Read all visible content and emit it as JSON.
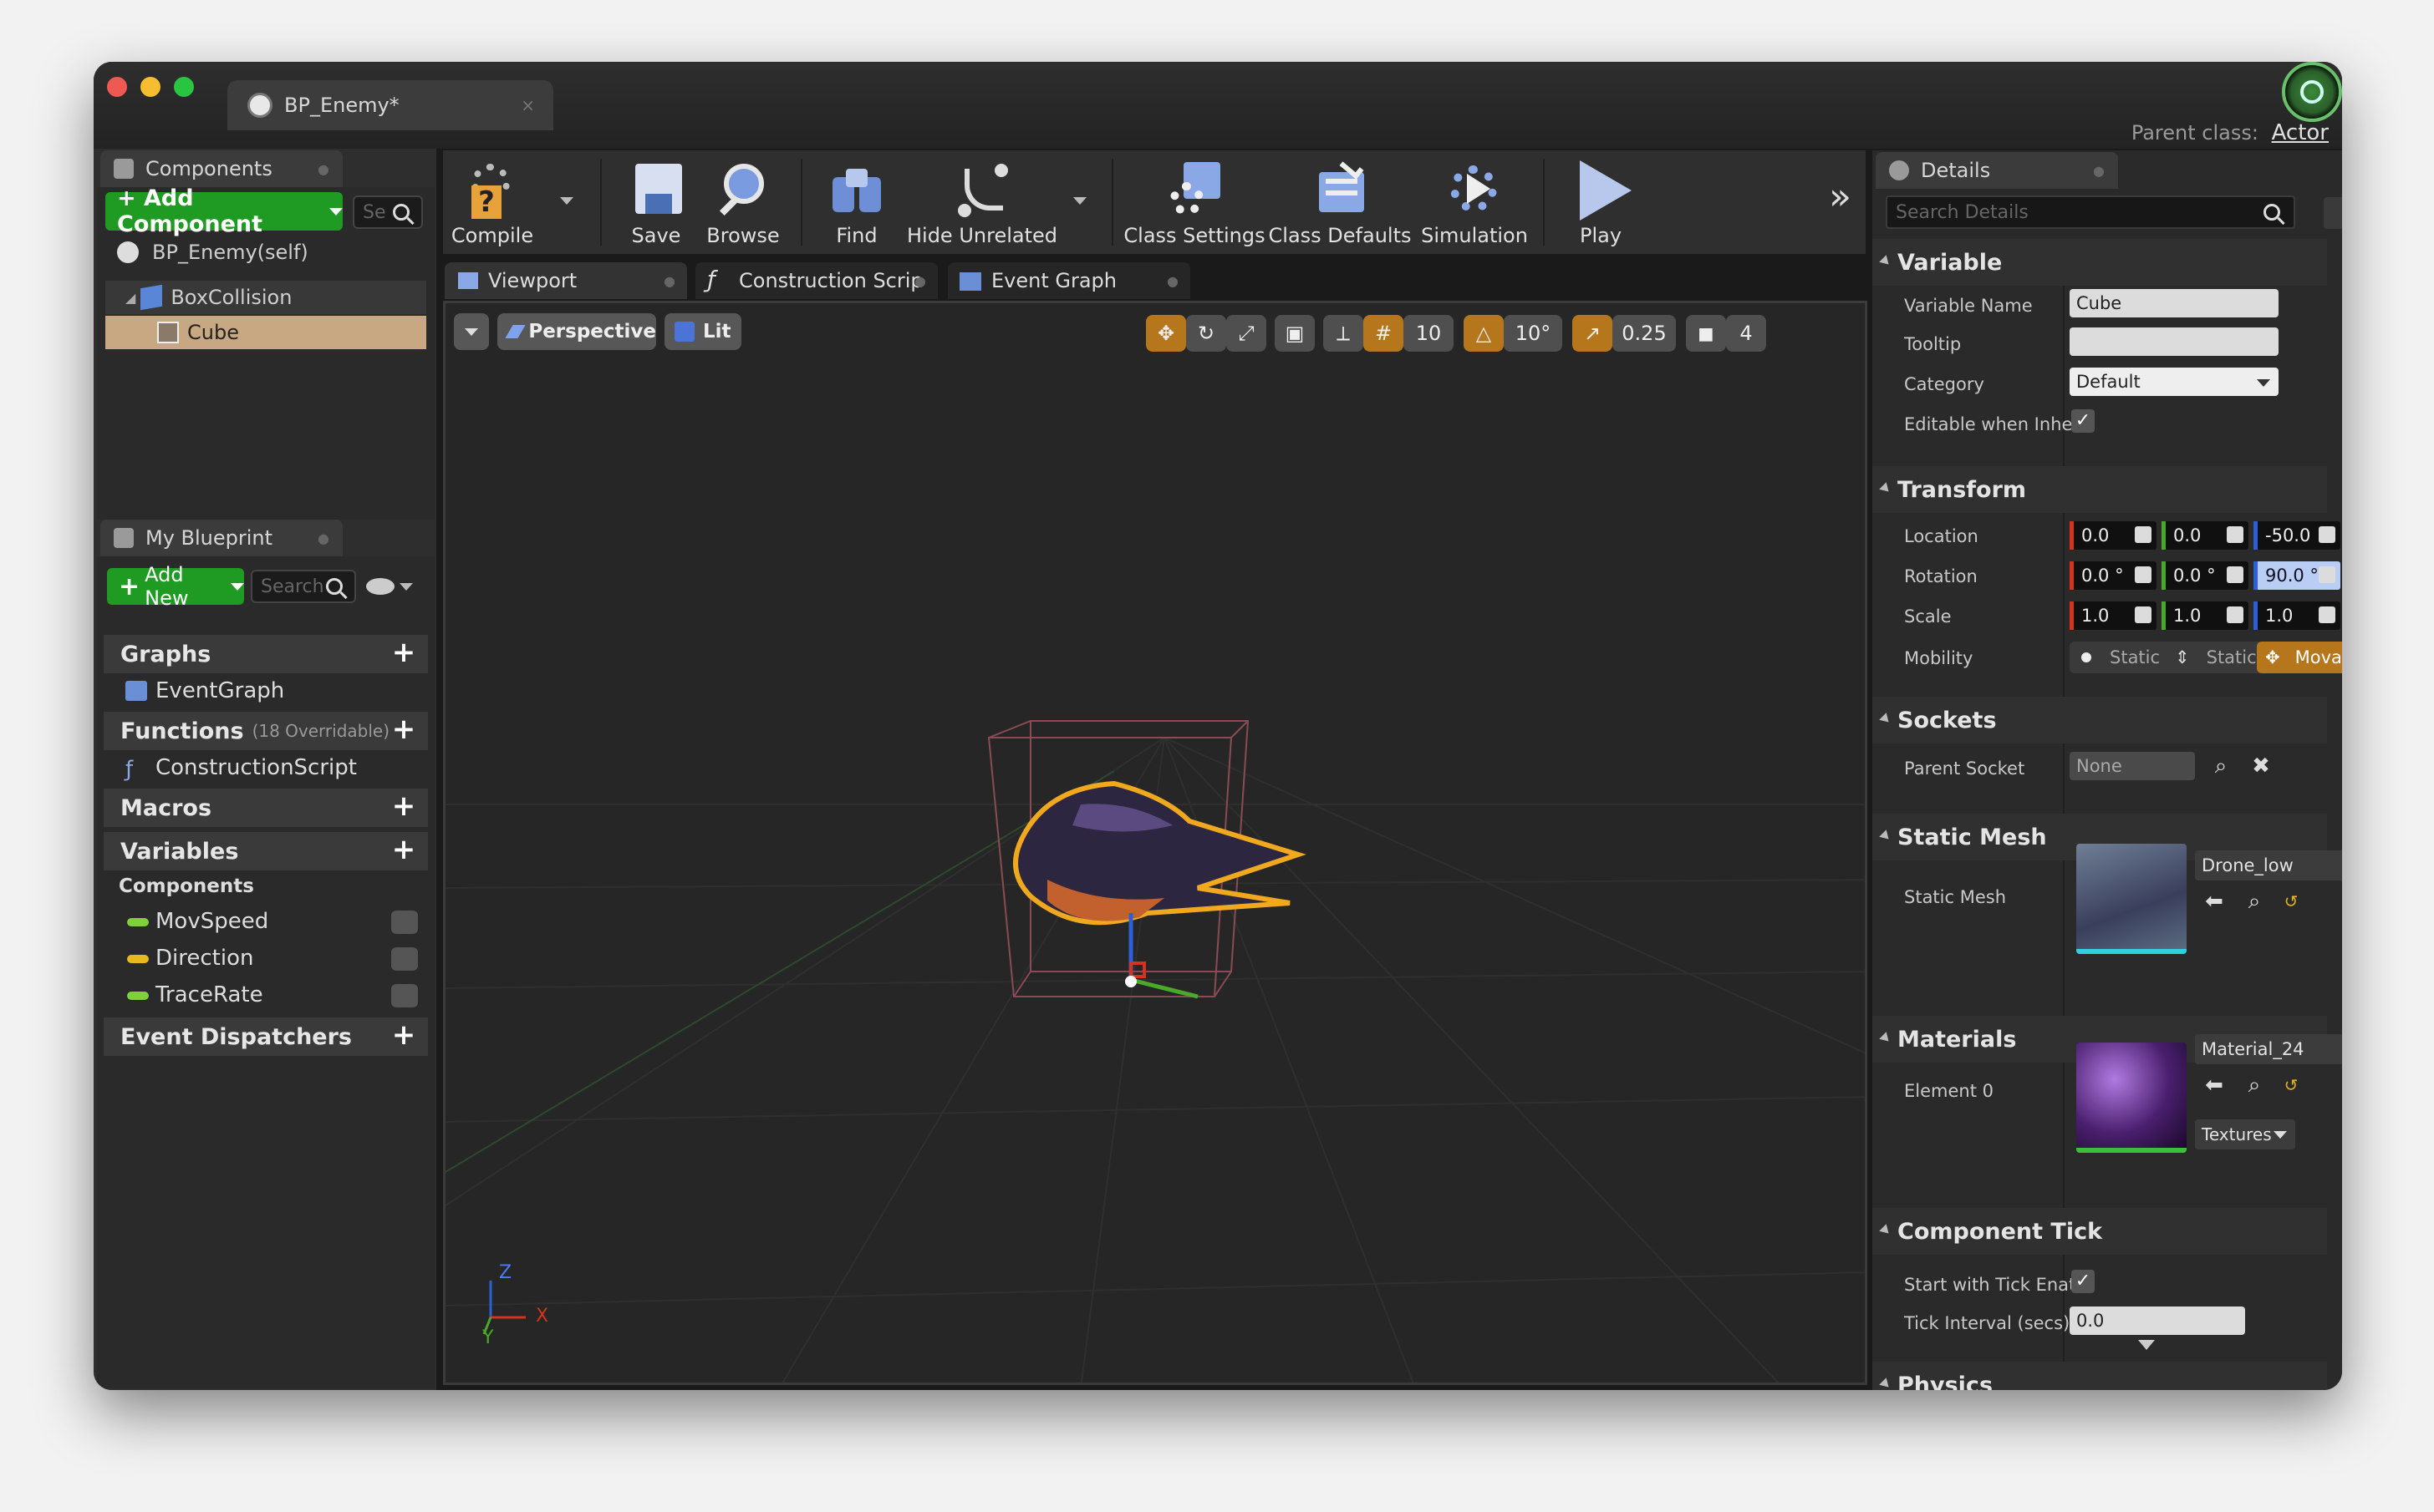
{
  "window": {
    "doc_tab": "BP_Enemy*",
    "parent_class_label": "Parent class:",
    "parent_class_value": "Actor"
  },
  "components_panel": {
    "tab": "Components",
    "add_button": "+ Add Component",
    "search_placeholder": "Se",
    "tree": [
      {
        "label": "BP_Enemy(self)"
      },
      {
        "label": "BoxCollision"
      },
      {
        "label": "Cube",
        "selected": true
      }
    ]
  },
  "my_blueprint": {
    "tab": "My Blueprint",
    "add_button": "Add New",
    "search_placeholder": "Search",
    "sections": {
      "graphs": "Graphs",
      "functions": "Functions",
      "functions_note": "(18 Overridable)",
      "macros": "Macros",
      "variables": "Variables",
      "event_dispatchers": "Event Dispatchers"
    },
    "items": {
      "event_graph": "EventGraph",
      "construction_script": "ConstructionScript",
      "components_group": "Components",
      "variables": [
        {
          "label": "MovSpeed",
          "color": "#7fd13b"
        },
        {
          "label": "Direction",
          "color": "#e8b91e"
        },
        {
          "label": "TraceRate",
          "color": "#7fd13b"
        }
      ]
    }
  },
  "toolbar": {
    "buttons": [
      "Compile",
      "Save",
      "Browse",
      "Find",
      "Hide Unrelated",
      "Class Settings",
      "Class Defaults",
      "Simulation",
      "Play"
    ],
    "overflow": "»"
  },
  "editor_tabs": [
    "Viewport",
    "Construction Scrip",
    "Event Graph"
  ],
  "viewport": {
    "perspective": "Perspective",
    "lit": "Lit",
    "grid_snap": "10",
    "rotation_snap": "10°",
    "scale_snap": "0.25",
    "camera_speed": "4",
    "axis_labels": {
      "z": "Z",
      "y": "Y",
      "x": "X"
    }
  },
  "details": {
    "tab": "Details",
    "search_placeholder": "Search Details",
    "variable": {
      "section": "Variable",
      "name_label": "Variable Name",
      "name_value": "Cube",
      "tooltip_label": "Tooltip",
      "category_label": "Category",
      "category_value": "Default",
      "editable_label": "Editable when Inher"
    },
    "transform": {
      "section": "Transform",
      "location_label": "Location",
      "location": [
        "0.0",
        "0.0",
        "-50.0"
      ],
      "rotation_label": "Rotation",
      "rotation": [
        "0.0 °",
        "0.0 °",
        "90.0 °"
      ],
      "scale_label": "Scale",
      "scale": [
        "1.0",
        "1.0",
        "1.0"
      ],
      "mobility_label": "Mobility",
      "mobility_options": [
        "Static",
        "Static",
        "Mova"
      ]
    },
    "sockets": {
      "section": "Sockets",
      "parent_label": "Parent Socket",
      "parent_value": "None"
    },
    "static_mesh": {
      "section": "Static Mesh",
      "label": "Static Mesh",
      "value": "Drone_low"
    },
    "materials": {
      "section": "Materials",
      "label": "Element 0",
      "value": "Material_24",
      "textures_button": "Textures"
    },
    "component_tick": {
      "section": "Component Tick",
      "start_label": "Start with Tick Enat",
      "interval_label": "Tick Interval (secs)",
      "interval_value": "0.0"
    },
    "physics": {
      "section": "Physics"
    }
  }
}
